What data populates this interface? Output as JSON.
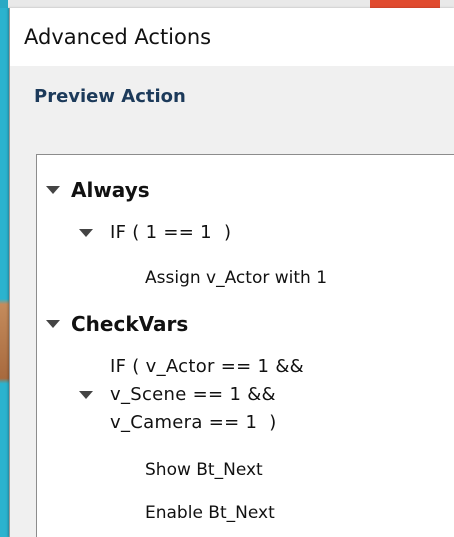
{
  "window": {
    "title": "Advanced Actions"
  },
  "preview": {
    "section_label": "Preview Action"
  },
  "tree": [
    {
      "name": "Always",
      "condition": "IF ( 1 == 1  )",
      "actions": [
        "Assign v_Actor with 1"
      ]
    },
    {
      "name": "CheckVars",
      "condition_lines": [
        "IF ( v_Actor == 1 &&",
        "v_Scene == 1 &&",
        "v_Camera == 1  )"
      ],
      "actions": [
        "Show Bt_Next",
        "Enable Bt_Next"
      ]
    }
  ],
  "icons": {
    "expand": "triangle-down-icon"
  },
  "colors": {
    "accent_background": "#2aa9c4",
    "section_label": "#1c3a5a"
  }
}
